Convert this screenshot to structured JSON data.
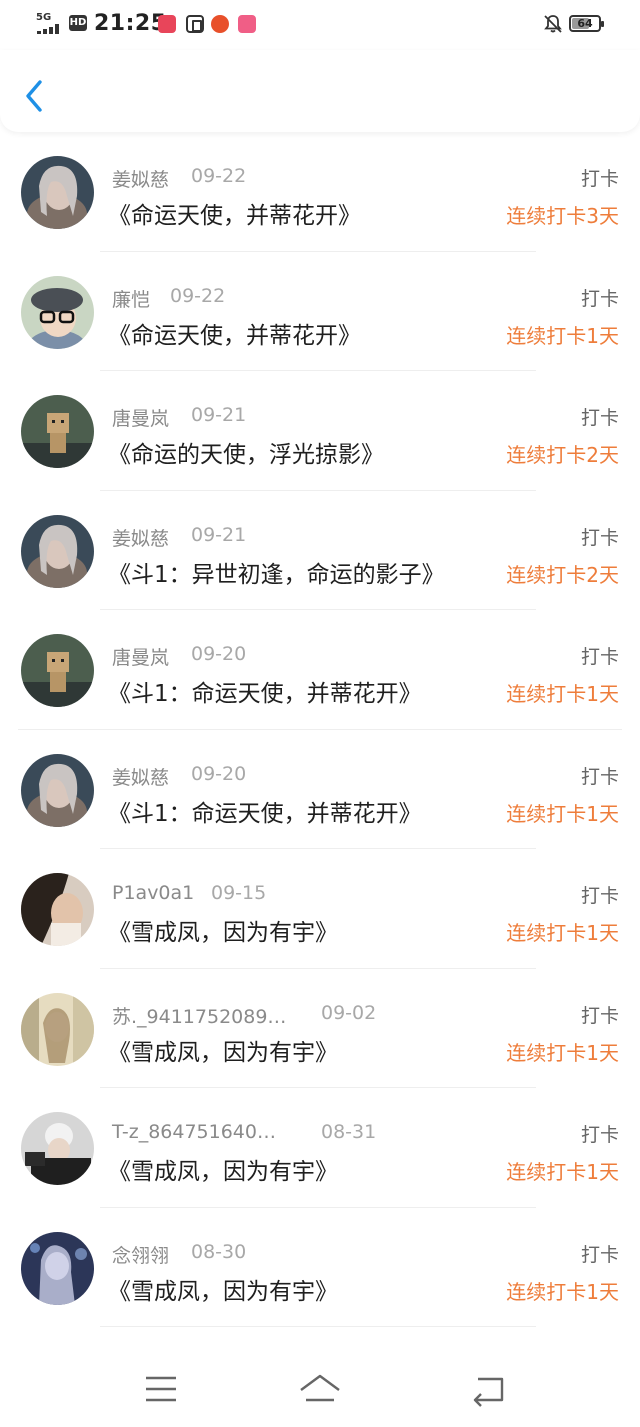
{
  "status_bar": {
    "network": "5G",
    "hd": "HD",
    "time": "21:25",
    "battery": "64",
    "battery_level": 0.64
  },
  "header": {
    "back_icon": "chevron-left-icon"
  },
  "items": [
    {
      "username": "姜姒慈",
      "date": "09-22",
      "book": "《命运天使，并蒂花开》",
      "type": "打卡",
      "streak": "连续打卡3天"
    },
    {
      "username": "廉恺",
      "date": "09-22",
      "book": "《命运天使，并蒂花开》",
      "type": "打卡",
      "streak": "连续打卡1天"
    },
    {
      "username": "唐曼岚",
      "date": "09-21",
      "book": "《命运的天使，浮光掠影》",
      "type": "打卡",
      "streak": "连续打卡2天"
    },
    {
      "username": "姜姒慈",
      "date": "09-21",
      "book": "《斗1：异世初逢，命运的影子》",
      "type": "打卡",
      "streak": "连续打卡2天"
    },
    {
      "username": "唐曼岚",
      "date": "09-20",
      "book": "《斗1：命运天使，并蒂花开》",
      "type": "打卡",
      "streak": "连续打卡1天"
    },
    {
      "username": "姜姒慈",
      "date": "09-20",
      "book": "《斗1：命运天使，并蒂花开》",
      "type": "打卡",
      "streak": "连续打卡1天"
    },
    {
      "username": "P1av0a1",
      "date": "09-15",
      "book": "《雪成凤，因为有宇》",
      "type": "打卡",
      "streak": "连续打卡1天"
    },
    {
      "username": "苏._9411752089…",
      "date": "09-02",
      "book": "《雪成凤，因为有宇》",
      "type": "打卡",
      "streak": "连续打卡1天"
    },
    {
      "username": "T-z_864751640…",
      "date": "08-31",
      "book": "《雪成凤，因为有宇》",
      "type": "打卡",
      "streak": "连续打卡1天"
    },
    {
      "username": "念翎翎",
      "date": "08-30",
      "book": "《雪成凤，因为有宇》",
      "type": "打卡",
      "streak": "连续打卡1天"
    }
  ],
  "colors": {
    "accent_blue": "#1e90e6",
    "streak_orange": "#ee7d3b",
    "meta_gray": "#8a8a8a"
  },
  "nav_bar": {
    "icons": [
      "menu-icon",
      "home-icon",
      "back-icon"
    ]
  }
}
